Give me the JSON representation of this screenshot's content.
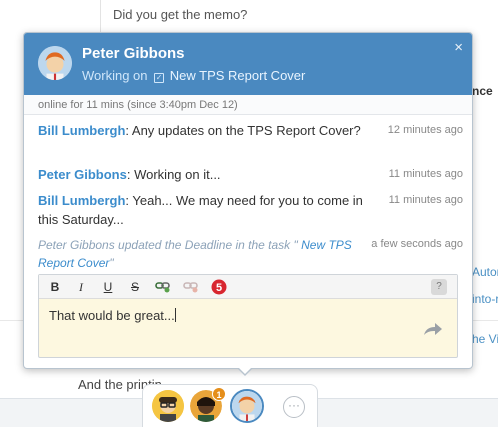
{
  "background": {
    "top_message": "Did you get the memo?",
    "right_fragment_1": "nce",
    "right_fragment_2": "Automat",
    "right_fragment_3": "into-r",
    "right_fragment_4": "he Vi",
    "bottom_text": "And the printin"
  },
  "popup": {
    "name": "Peter Gibbons",
    "status_prefix": "Working on",
    "status_task": "New TPS Report Cover",
    "close_symbol": "×",
    "online_text": "online for 11 mins (since 3:40pm Dec 12)"
  },
  "messages": [
    {
      "author": "Bill Lumbergh",
      "text": ": Any updates on the TPS Report Cover?",
      "time": "12 minutes ago"
    },
    {
      "author": "Peter Gibbons",
      "text": ": Working on it...",
      "time": "11 minutes ago"
    },
    {
      "author": "Bill Lumbergh",
      "text": ": Yeah... We may need for you to come in this Saturday...",
      "time": "11 minutes ago"
    }
  ],
  "activity": {
    "text": "Peter Gibbons  updated the Deadline in the task \"",
    "task": " New TPS Report Cover",
    "end": "\"",
    "time": "a few seconds ago"
  },
  "toolbar": {
    "bold": "B",
    "italic": "I",
    "underline": "U",
    "strike": "S",
    "help": "?"
  },
  "editor": {
    "value": "That would be great..."
  },
  "tray": {
    "badge_count": "1",
    "more": "···"
  },
  "colors": {
    "header": "#4a89c0",
    "link": "#3b8ccc",
    "editor_bg": "#fdf8e0",
    "badge": "#e58e1a"
  },
  "icons": [
    "checkbox-icon",
    "close-icon",
    "link-icon",
    "unlink-icon",
    "emoji-icon",
    "help-icon",
    "send-icon",
    "more-icon"
  ]
}
